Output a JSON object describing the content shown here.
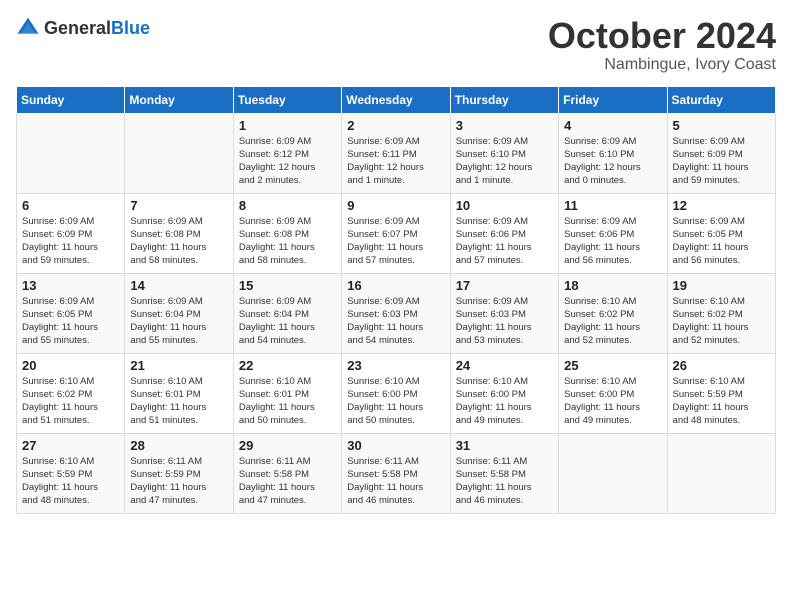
{
  "logo": {
    "general": "General",
    "blue": "Blue"
  },
  "title": "October 2024",
  "location": "Nambingue, Ivory Coast",
  "days_of_week": [
    "Sunday",
    "Monday",
    "Tuesday",
    "Wednesday",
    "Thursday",
    "Friday",
    "Saturday"
  ],
  "weeks": [
    [
      {
        "day": "",
        "info": ""
      },
      {
        "day": "",
        "info": ""
      },
      {
        "day": "1",
        "info": "Sunrise: 6:09 AM\nSunset: 6:12 PM\nDaylight: 12 hours\nand 2 minutes."
      },
      {
        "day": "2",
        "info": "Sunrise: 6:09 AM\nSunset: 6:11 PM\nDaylight: 12 hours\nand 1 minute."
      },
      {
        "day": "3",
        "info": "Sunrise: 6:09 AM\nSunset: 6:10 PM\nDaylight: 12 hours\nand 1 minute."
      },
      {
        "day": "4",
        "info": "Sunrise: 6:09 AM\nSunset: 6:10 PM\nDaylight: 12 hours\nand 0 minutes."
      },
      {
        "day": "5",
        "info": "Sunrise: 6:09 AM\nSunset: 6:09 PM\nDaylight: 11 hours\nand 59 minutes."
      }
    ],
    [
      {
        "day": "6",
        "info": "Sunrise: 6:09 AM\nSunset: 6:09 PM\nDaylight: 11 hours\nand 59 minutes."
      },
      {
        "day": "7",
        "info": "Sunrise: 6:09 AM\nSunset: 6:08 PM\nDaylight: 11 hours\nand 58 minutes."
      },
      {
        "day": "8",
        "info": "Sunrise: 6:09 AM\nSunset: 6:08 PM\nDaylight: 11 hours\nand 58 minutes."
      },
      {
        "day": "9",
        "info": "Sunrise: 6:09 AM\nSunset: 6:07 PM\nDaylight: 11 hours\nand 57 minutes."
      },
      {
        "day": "10",
        "info": "Sunrise: 6:09 AM\nSunset: 6:06 PM\nDaylight: 11 hours\nand 57 minutes."
      },
      {
        "day": "11",
        "info": "Sunrise: 6:09 AM\nSunset: 6:06 PM\nDaylight: 11 hours\nand 56 minutes."
      },
      {
        "day": "12",
        "info": "Sunrise: 6:09 AM\nSunset: 6:05 PM\nDaylight: 11 hours\nand 56 minutes."
      }
    ],
    [
      {
        "day": "13",
        "info": "Sunrise: 6:09 AM\nSunset: 6:05 PM\nDaylight: 11 hours\nand 55 minutes."
      },
      {
        "day": "14",
        "info": "Sunrise: 6:09 AM\nSunset: 6:04 PM\nDaylight: 11 hours\nand 55 minutes."
      },
      {
        "day": "15",
        "info": "Sunrise: 6:09 AM\nSunset: 6:04 PM\nDaylight: 11 hours\nand 54 minutes."
      },
      {
        "day": "16",
        "info": "Sunrise: 6:09 AM\nSunset: 6:03 PM\nDaylight: 11 hours\nand 54 minutes."
      },
      {
        "day": "17",
        "info": "Sunrise: 6:09 AM\nSunset: 6:03 PM\nDaylight: 11 hours\nand 53 minutes."
      },
      {
        "day": "18",
        "info": "Sunrise: 6:10 AM\nSunset: 6:02 PM\nDaylight: 11 hours\nand 52 minutes."
      },
      {
        "day": "19",
        "info": "Sunrise: 6:10 AM\nSunset: 6:02 PM\nDaylight: 11 hours\nand 52 minutes."
      }
    ],
    [
      {
        "day": "20",
        "info": "Sunrise: 6:10 AM\nSunset: 6:02 PM\nDaylight: 11 hours\nand 51 minutes."
      },
      {
        "day": "21",
        "info": "Sunrise: 6:10 AM\nSunset: 6:01 PM\nDaylight: 11 hours\nand 51 minutes."
      },
      {
        "day": "22",
        "info": "Sunrise: 6:10 AM\nSunset: 6:01 PM\nDaylight: 11 hours\nand 50 minutes."
      },
      {
        "day": "23",
        "info": "Sunrise: 6:10 AM\nSunset: 6:00 PM\nDaylight: 11 hours\nand 50 minutes."
      },
      {
        "day": "24",
        "info": "Sunrise: 6:10 AM\nSunset: 6:00 PM\nDaylight: 11 hours\nand 49 minutes."
      },
      {
        "day": "25",
        "info": "Sunrise: 6:10 AM\nSunset: 6:00 PM\nDaylight: 11 hours\nand 49 minutes."
      },
      {
        "day": "26",
        "info": "Sunrise: 6:10 AM\nSunset: 5:59 PM\nDaylight: 11 hours\nand 48 minutes."
      }
    ],
    [
      {
        "day": "27",
        "info": "Sunrise: 6:10 AM\nSunset: 5:59 PM\nDaylight: 11 hours\nand 48 minutes."
      },
      {
        "day": "28",
        "info": "Sunrise: 6:11 AM\nSunset: 5:59 PM\nDaylight: 11 hours\nand 47 minutes."
      },
      {
        "day": "29",
        "info": "Sunrise: 6:11 AM\nSunset: 5:58 PM\nDaylight: 11 hours\nand 47 minutes."
      },
      {
        "day": "30",
        "info": "Sunrise: 6:11 AM\nSunset: 5:58 PM\nDaylight: 11 hours\nand 46 minutes."
      },
      {
        "day": "31",
        "info": "Sunrise: 6:11 AM\nSunset: 5:58 PM\nDaylight: 11 hours\nand 46 minutes."
      },
      {
        "day": "",
        "info": ""
      },
      {
        "day": "",
        "info": ""
      }
    ]
  ]
}
